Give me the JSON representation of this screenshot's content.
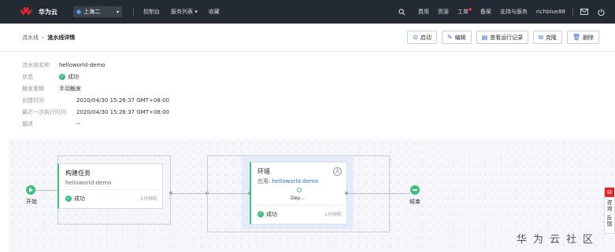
{
  "topbar": {
    "brand": "华为云",
    "region": "上海二",
    "nav": [
      "控制台",
      "服务列表 ▾",
      "收藏"
    ],
    "right": [
      "费用",
      "资源",
      "工单",
      "备案",
      "支持与服务",
      "richblue88"
    ],
    "icons": [
      "search-icon",
      "mail-icon",
      "power-icon"
    ]
  },
  "breadcrumb": {
    "parent": "流水线",
    "sep": "›",
    "current": "流水线详情"
  },
  "actions": [
    {
      "label": "启动",
      "icon": "play-icon"
    },
    {
      "label": "编辑",
      "icon": "pencil-icon"
    },
    {
      "label": "查看运行记录",
      "icon": "list-icon"
    },
    {
      "label": "克隆",
      "icon": "clone-icon"
    },
    {
      "label": "删除",
      "icon": "trash-icon"
    }
  ],
  "info": {
    "name_k": "流水线名称",
    "name_v": "helloworld-demo",
    "status_k": "状态",
    "status_v": "成功",
    "trigger_k": "触发策略",
    "trigger_v": "手动触发",
    "created_k": "创建时间",
    "created_v": "2020/04/30 15:26:37 GMT+08:00",
    "last_k": "最近一次执行时间",
    "last_v": "2020/04/30 15:26:37 GMT+08:00",
    "desc_k": "描述",
    "desc_v": "--"
  },
  "flow": {
    "start": "开始",
    "end": "结束",
    "build": {
      "title": "构建任务",
      "sub": "helloworld-demo",
      "status": "成功",
      "time": "2分钟前"
    },
    "env": {
      "title": "环境",
      "app_label": "应用:",
      "app_value": "helloworld-demo",
      "dep": "Dep...",
      "status": "成功",
      "time": "1分钟前"
    }
  },
  "watermark": "华为云社区",
  "side_tab": "咨询·反馈",
  "colors": {
    "success": "#3ec07a",
    "accent": "#2a6fd6",
    "topbar": "#242a33",
    "brand_red": "#e1262d"
  }
}
